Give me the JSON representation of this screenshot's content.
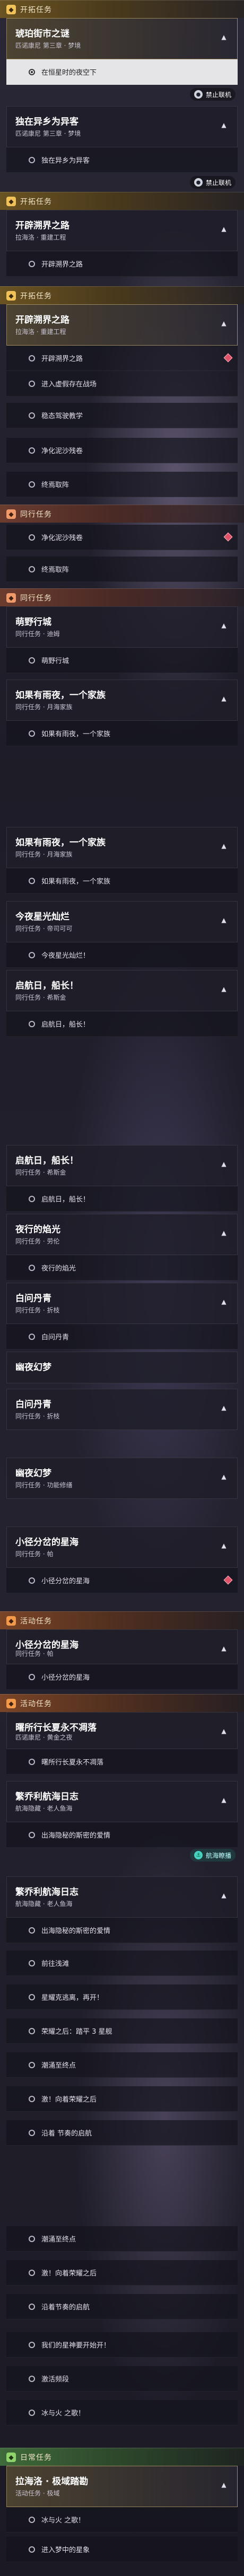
{
  "categories": {
    "main": "开拓任务",
    "companion": "同行任务",
    "event": "活动任务",
    "daily": "日常任务"
  },
  "icons": {
    "category": "diamond-icon",
    "chevron": "chevron-up-icon",
    "step": "radio-dot-icon",
    "mark": "red-diamond-marker-icon"
  },
  "banners": {
    "no_coop": "禁止联机",
    "stargaze": "航海瞭播"
  },
  "quests": [
    {
      "title": "琥珀街市之谜",
      "sub": "匹诺康尼 第三章 · 梦境"
    },
    {
      "title": "独在异乡为异客",
      "sub": "匹诺康尼 第三章 · 梦境"
    },
    {
      "title": "开辟溯界之路",
      "sub": "拉海洛 · 重建工程"
    },
    {
      "title": "开辟溯界之路",
      "sub": "拉海洛 · 重建工程"
    },
    {
      "title": "萌野行城",
      "sub": "同行任务 · 迪姆"
    },
    {
      "title": "如果有雨夜，一个家族",
      "sub": "同行任务 · 月海家族"
    },
    {
      "title": "如果有雨夜，一个家族",
      "sub": "同行任务 · 月海家族"
    },
    {
      "title": "今夜星光灿烂",
      "sub": "同行任务 · 帝司可可"
    },
    {
      "title": "启航日，船长！",
      "sub": "同行任务 · 希斯金"
    },
    {
      "title": "启航日，船长！",
      "sub": "同行任务 · 希斯金"
    },
    {
      "title": "夜行的焰光",
      "sub": "同行任务 · 劳伦"
    },
    {
      "title": "白问丹青",
      "sub": "同行任务 · 折枝"
    },
    {
      "title": "幽夜幻梦",
      "sub": "同行任务 · 劳伦"
    },
    {
      "title": "白问丹青",
      "sub": "同行任务 · 折枝"
    },
    {
      "title": "幽夜幻梦",
      "sub": "同行任务 · 功能修缮"
    },
    {
      "title": "小径分岔的星海",
      "sub": "同行任务 · 帕"
    },
    {
      "title": "小径分岔的星海",
      "sub": "同行任务 · 帕"
    },
    {
      "title": "曙所行长夏永不凋落",
      "sub": "匹诺康尼 · 黄金之夜"
    },
    {
      "title": "繁乔利航海日志",
      "sub": "航海隐藏 · 老人鱼海"
    },
    {
      "title": "繁乔利航海日志",
      "sub": "航海隐藏 · 老人鱼海"
    },
    {
      "title": "拉海洛 · 极域踏勘",
      "sub": "活动任务 · 极域"
    }
  ],
  "steps": [
    "在恒星时的夜空下",
    "独在异乡为异客",
    "开辟溯界之路",
    "进入虚假存在战场",
    "稳态驾驶教学",
    "净化泥沙残卷",
    "终焉取阵",
    "净化泥沙残卷",
    "终焉取阵",
    "萌野行城",
    "如果有雨夜，一个家族",
    "如果有雨夜，一个家族",
    "今夜星光灿烂！",
    "启航日，船长！",
    "启航日，船长！",
    "夜行的焰光",
    "白问丹青",
    "小径分岔的星海",
    "曙所行长夏永不凋落",
    "出海隐秘的斯密的爱情",
    "出海隐秘的斯密的爱情",
    "前往浅滩",
    "星耀克逃离，再开！",
    "荣耀之后：踏平 3 星舰",
    "潮涌至终点",
    "激！向着荣耀之后",
    "沿着 节奏的启航",
    "潮涌至终点",
    "激！向着荣耀之后",
    "沿着节奏的启航",
    "我们的星神要开始开！",
    "激活频段",
    "冰与火 之歌！",
    "进入梦中的星象"
  ]
}
